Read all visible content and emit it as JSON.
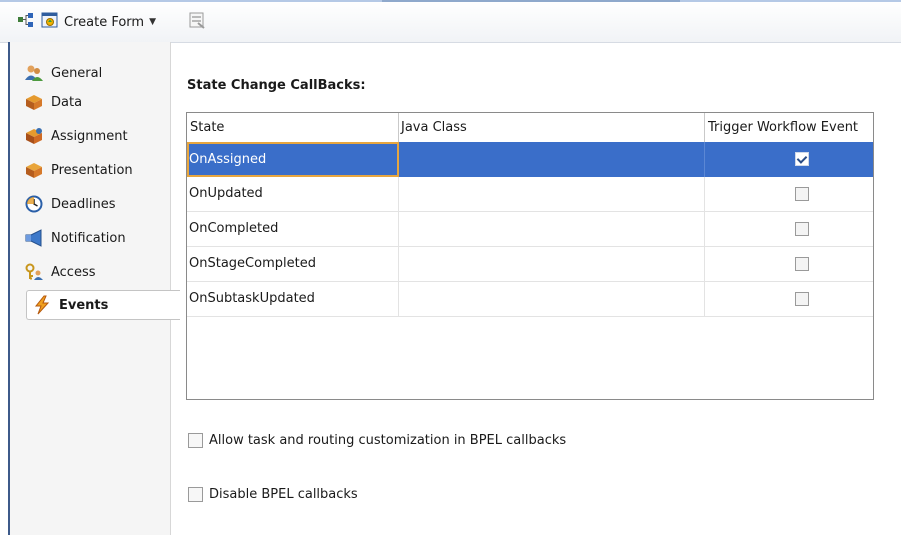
{
  "toolbar": {
    "create_form_label": "Create Form",
    "icons": [
      "workflow-diagram-icon",
      "create-form-icon",
      "form-preview-icon"
    ]
  },
  "sidebar": {
    "items": [
      {
        "label": "General",
        "icon": "people-icon",
        "selected": false
      },
      {
        "label": "Data",
        "icon": "data-cube-icon",
        "selected": false
      },
      {
        "label": "Assignment",
        "icon": "assignment-icon",
        "selected": false
      },
      {
        "label": "Presentation",
        "icon": "presentation-icon",
        "selected": false
      },
      {
        "label": "Deadlines",
        "icon": "clock-icon",
        "selected": false
      },
      {
        "label": "Notification",
        "icon": "megaphone-icon",
        "selected": false
      },
      {
        "label": "Access",
        "icon": "key-user-icon",
        "selected": false
      },
      {
        "label": "Events",
        "icon": "lightning-icon",
        "selected": true
      }
    ]
  },
  "main": {
    "section_title": "State Change CallBacks:",
    "table": {
      "columns": [
        "State",
        "Java Class",
        "Trigger Workflow Event"
      ],
      "rows": [
        {
          "state": "OnAssigned",
          "java_class": "",
          "trigger": true,
          "selected": true
        },
        {
          "state": "OnUpdated",
          "java_class": "",
          "trigger": false,
          "selected": false
        },
        {
          "state": "OnCompleted",
          "java_class": "",
          "trigger": false,
          "selected": false
        },
        {
          "state": "OnStageCompleted",
          "java_class": "",
          "trigger": false,
          "selected": false
        },
        {
          "state": "OnSubtaskUpdated",
          "java_class": "",
          "trigger": false,
          "selected": false
        }
      ]
    },
    "options": [
      {
        "label": "Allow task and routing customization in BPEL callbacks",
        "checked": false
      },
      {
        "label": "Disable BPEL callbacks",
        "checked": false
      }
    ]
  },
  "colors": {
    "selection": "#3a6ec9",
    "focus_border": "#e7a640",
    "window_accent": "#3d5a8a"
  }
}
